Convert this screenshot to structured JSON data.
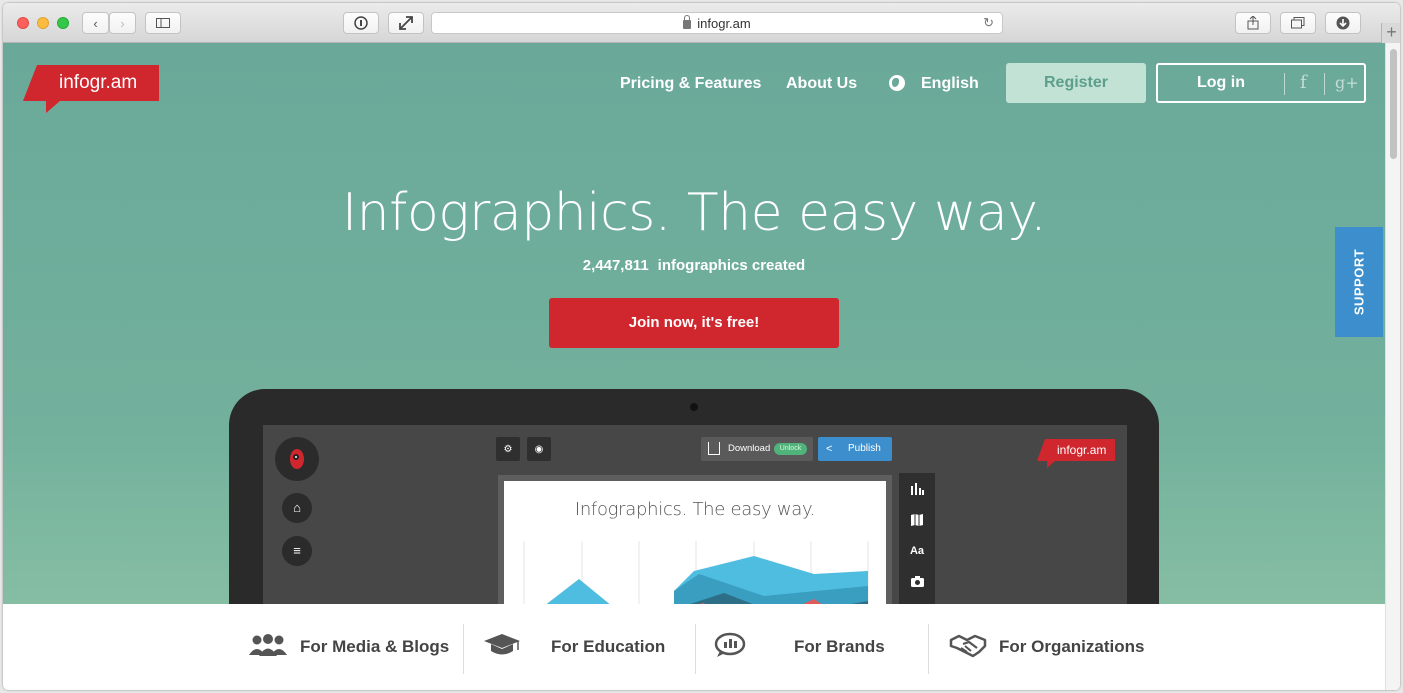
{
  "browser": {
    "url": "infogr.am"
  },
  "site": {
    "logo": "infogr.am",
    "nav": {
      "pricing": "Pricing & Features",
      "about": "About Us",
      "language": "English",
      "register": "Register",
      "login": "Log in",
      "facebook": "f",
      "google_plus": "g+"
    },
    "support": "SUPPORT",
    "hero": {
      "title": "Infographics. The easy way.",
      "count": "2,447,811",
      "count_label": "infographics created",
      "cta": "Join now, it's free!"
    },
    "editor": {
      "download": "Download",
      "unlock": "Unlock",
      "publish": "Publish",
      "logo": "infogr.am",
      "canvas_title": "Infographics. The easy way.",
      "text_tool": "Aa"
    },
    "categories": [
      {
        "label": "For Media & Blogs",
        "icon": "people-icon"
      },
      {
        "label": "For Education",
        "icon": "graduation-cap-icon"
      },
      {
        "label": "For Brands",
        "icon": "chat-bubble-chart-icon"
      },
      {
        "label": "For Organizations",
        "icon": "handshake-icon"
      }
    ]
  },
  "colors": {
    "brand_red": "#d0262e",
    "hero_green": "#6aa899",
    "support_blue": "#3c8fcc"
  }
}
